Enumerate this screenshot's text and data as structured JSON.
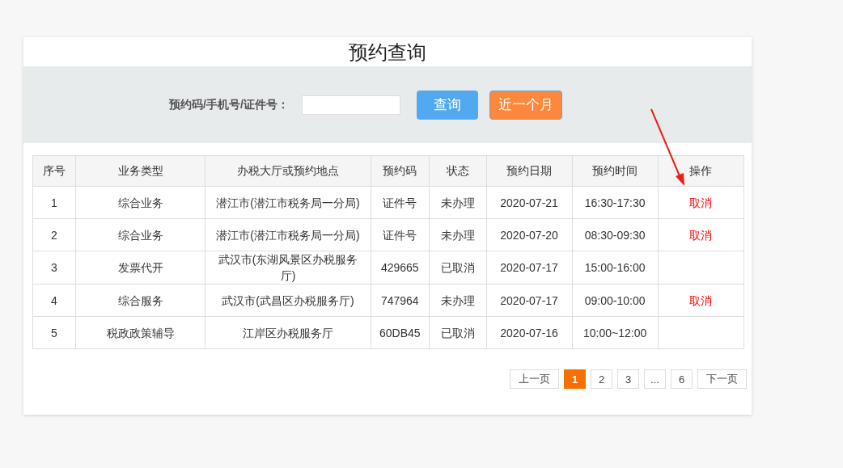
{
  "title": "预约查询",
  "search": {
    "label": "预约码/手机号/证件号：",
    "buttons": [
      {
        "label": "查询",
        "kind": "primary"
      },
      {
        "label": "近一个月",
        "kind": "accent"
      }
    ]
  },
  "table": {
    "columns": [
      "序号",
      "业务类型",
      "办税大厅或预约地点",
      "预约码",
      "状态",
      "预约日期",
      "预约时间",
      "操作"
    ],
    "rows": [
      {
        "cells": [
          "1",
          "综合业务",
          "潜江市(潜江市税务局一分局)",
          "证件号",
          "未办理",
          "2020-07-21",
          "16:30-17:30"
        ],
        "action": "取消"
      },
      {
        "cells": [
          "2",
          "综合业务",
          "潜江市(潜江市税务局一分局)",
          "证件号",
          "未办理",
          "2020-07-20",
          "08:30-09:30"
        ],
        "action": "取消"
      },
      {
        "cells": [
          "3",
          "发票代开",
          "武汉市(东湖风景区办税服务厅)",
          "429665",
          "已取消",
          "2020-07-17",
          "15:00-16:00"
        ]
      },
      {
        "cells": [
          "4",
          "综合服务",
          "武汉市(武昌区办税服务厅)",
          "747964",
          "未办理",
          "2020-07-17",
          "09:00-10:00"
        ],
        "action": "取消"
      },
      {
        "cells": [
          "5",
          "税政政策辅导",
          "江岸区办税服务厅",
          "60DB45",
          "已取消",
          "2020-07-16",
          "10:00~12:00"
        ]
      }
    ]
  },
  "pagination": {
    "prev": "上一页",
    "pages": [
      {
        "label": "1",
        "selected": true
      },
      {
        "label": "2",
        "selected": false
      },
      {
        "label": "3",
        "selected": false
      },
      {
        "label": "...",
        "selected": false
      },
      {
        "label": "6",
        "selected": false
      }
    ],
    "next": "下一页"
  }
}
